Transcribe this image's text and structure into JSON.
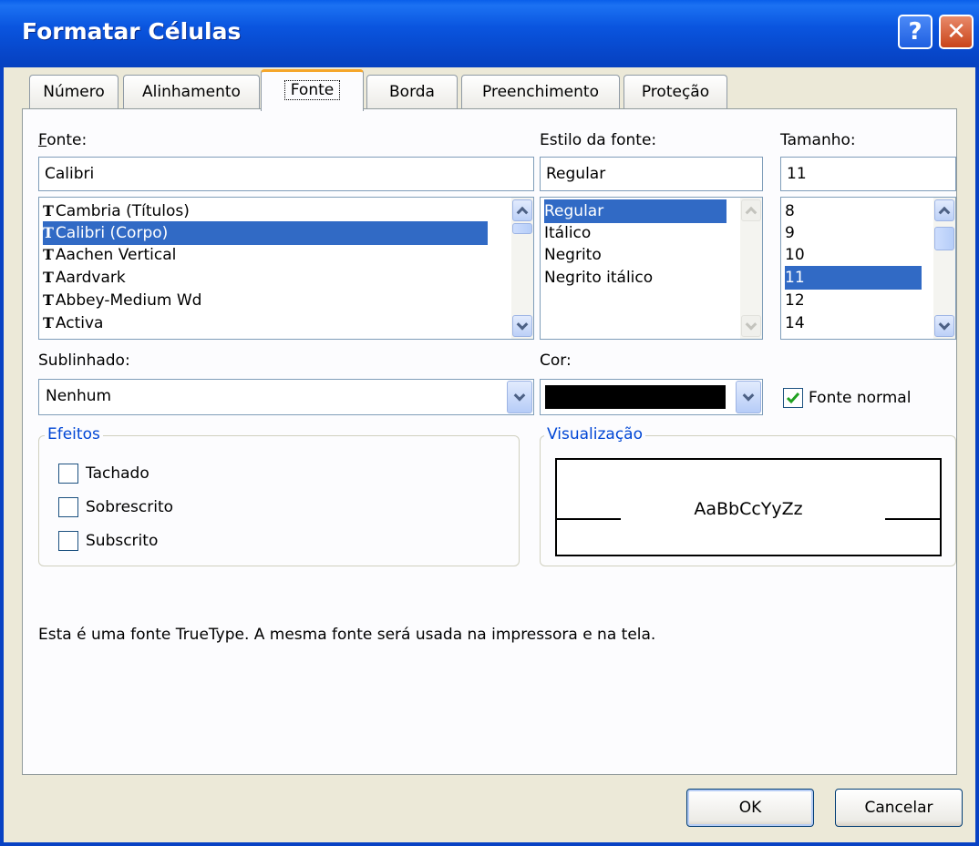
{
  "window": {
    "title": "Formatar Células",
    "help_label": "?",
    "close_label": "✕"
  },
  "tabs": [
    {
      "label": "Número"
    },
    {
      "label": "Alinhamento"
    },
    {
      "label": "Fonte"
    },
    {
      "label": "Borda"
    },
    {
      "label": "Preenchimento"
    },
    {
      "label": "Proteção"
    }
  ],
  "font": {
    "label": "Fonte:",
    "value": "Calibri",
    "items": [
      "Cambria (Títulos)",
      "Calibri (Corpo)",
      "Aachen Vertical",
      "Aardvark",
      "Abbey-Medium Wd",
      "Activa"
    ],
    "selected_index": 1,
    "icon_glyph": "T"
  },
  "style": {
    "label": "Estilo da fonte:",
    "value": "Regular",
    "items": [
      "Regular",
      "Itálico",
      "Negrito",
      "Negrito itálico"
    ],
    "selected_index": 0
  },
  "size": {
    "label": "Tamanho:",
    "value": "11",
    "items": [
      "8",
      "9",
      "10",
      "11",
      "12",
      "14"
    ],
    "selected_index": 3
  },
  "underline": {
    "label": "Sublinhado:",
    "value": "Nenhum"
  },
  "color": {
    "label": "Cor:",
    "swatch": "#000000"
  },
  "normal_font": {
    "label": "Fonte normal",
    "checked": true
  },
  "effects": {
    "title": "Efeitos",
    "items": [
      {
        "label": "Tachado",
        "checked": false
      },
      {
        "label": "Sobrescrito",
        "checked": false
      },
      {
        "label": "Subscrito",
        "checked": false
      }
    ]
  },
  "preview": {
    "title": "Visualização",
    "sample": "AaBbCcYyZz"
  },
  "info": "Esta é uma fonte TrueType. A mesma fonte será usada na impressora e na tela.",
  "buttons": {
    "ok": "OK",
    "cancel": "Cancelar"
  },
  "colors": {
    "selection": "#316ac5",
    "group_title": "#0046d5",
    "titlebar": "#0a55df",
    "check": "#21a121"
  }
}
